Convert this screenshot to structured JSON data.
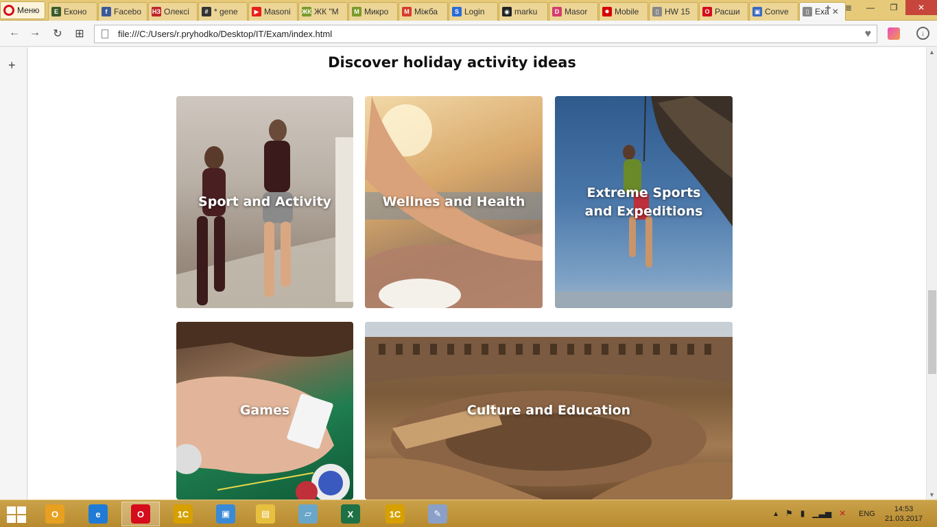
{
  "browser": {
    "menu_label": "Меню",
    "tabs": [
      {
        "title": "Еконо",
        "icon": "E",
        "color": "#3b5a2a"
      },
      {
        "title": "Facebo",
        "icon": "f",
        "color": "#3b5998"
      },
      {
        "title": "Олексі",
        "icon": "НЗ",
        "color": "#c0252a"
      },
      {
        "title": "* gene",
        "icon": "#",
        "color": "#333333"
      },
      {
        "title": "Masoni",
        "icon": "▶",
        "color": "#e62117"
      },
      {
        "title": "ЖК \"М",
        "icon": "ЖК",
        "color": "#7a9a2a"
      },
      {
        "title": "Микро",
        "icon": "М",
        "color": "#7a9a2a"
      },
      {
        "title": "Міжба",
        "icon": "M",
        "color": "#d63b2a"
      },
      {
        "title": "Login",
        "icon": "S",
        "color": "#2a6bd6"
      },
      {
        "title": "marku",
        "icon": "◉",
        "color": "#222222"
      },
      {
        "title": "Masor",
        "icon": "D",
        "color": "#d63b6a"
      },
      {
        "title": "Mobile",
        "icon": "✸",
        "color": "#d60000"
      },
      {
        "title": "HW 15",
        "icon": "▯",
        "color": "#888888"
      },
      {
        "title": "Расши",
        "icon": "O",
        "color": "#d40c1b"
      },
      {
        "title": "Conve",
        "icon": "▣",
        "color": "#3a6ac0"
      },
      {
        "title": "Exa",
        "icon": "▯",
        "color": "#888888"
      }
    ],
    "active_tab_close": "✕",
    "new_tab": "+",
    "tab_menu": "≡",
    "url": "file:///C:/Users/r.pryhodko/Desktop/IT/Exam/index.html",
    "window_controls": {
      "minimize": "—",
      "restore": "❐",
      "close": "✕"
    },
    "nav": {
      "back": "←",
      "forward": "→",
      "reload": "↻",
      "speed_dial": "⊞"
    },
    "bookmark_icon": "♥",
    "download_icon": "↓",
    "sidebar_add": "+"
  },
  "page": {
    "title": "Discover holiday activity ideas",
    "cards": [
      {
        "label": "Sport and Activity"
      },
      {
        "label": "Wellnes and Health"
      },
      {
        "label": "Extreme Sports\nand Expeditions"
      },
      {
        "label": "Games"
      },
      {
        "label": "Culture and Education"
      }
    ]
  },
  "taskbar": {
    "apps": [
      {
        "name": "outlook",
        "glyph": "O",
        "color": "#e8a020"
      },
      {
        "name": "internet-explorer",
        "glyph": "e",
        "color": "#1f7bd6"
      },
      {
        "name": "opera",
        "glyph": "O",
        "color": "#d40c1b"
      },
      {
        "name": "1c",
        "glyph": "1С",
        "color": "#d6a000"
      },
      {
        "name": "remote-app",
        "glyph": "▣",
        "color": "#3a8ad6"
      },
      {
        "name": "file-explorer",
        "glyph": "▤",
        "color": "#e8c040"
      },
      {
        "name": "documents",
        "glyph": "▱",
        "color": "#6aa6c9"
      },
      {
        "name": "excel",
        "glyph": "X",
        "color": "#1e7145"
      },
      {
        "name": "1c-2",
        "glyph": "1С",
        "color": "#d6a000"
      },
      {
        "name": "paint",
        "glyph": "✎",
        "color": "#8aa0c8"
      }
    ],
    "tray_icons": [
      "▴",
      "⚑",
      "▮",
      "▁▃▅",
      "✕"
    ],
    "language": "ENG",
    "time": "14:53",
    "date": "21.03.2017"
  }
}
